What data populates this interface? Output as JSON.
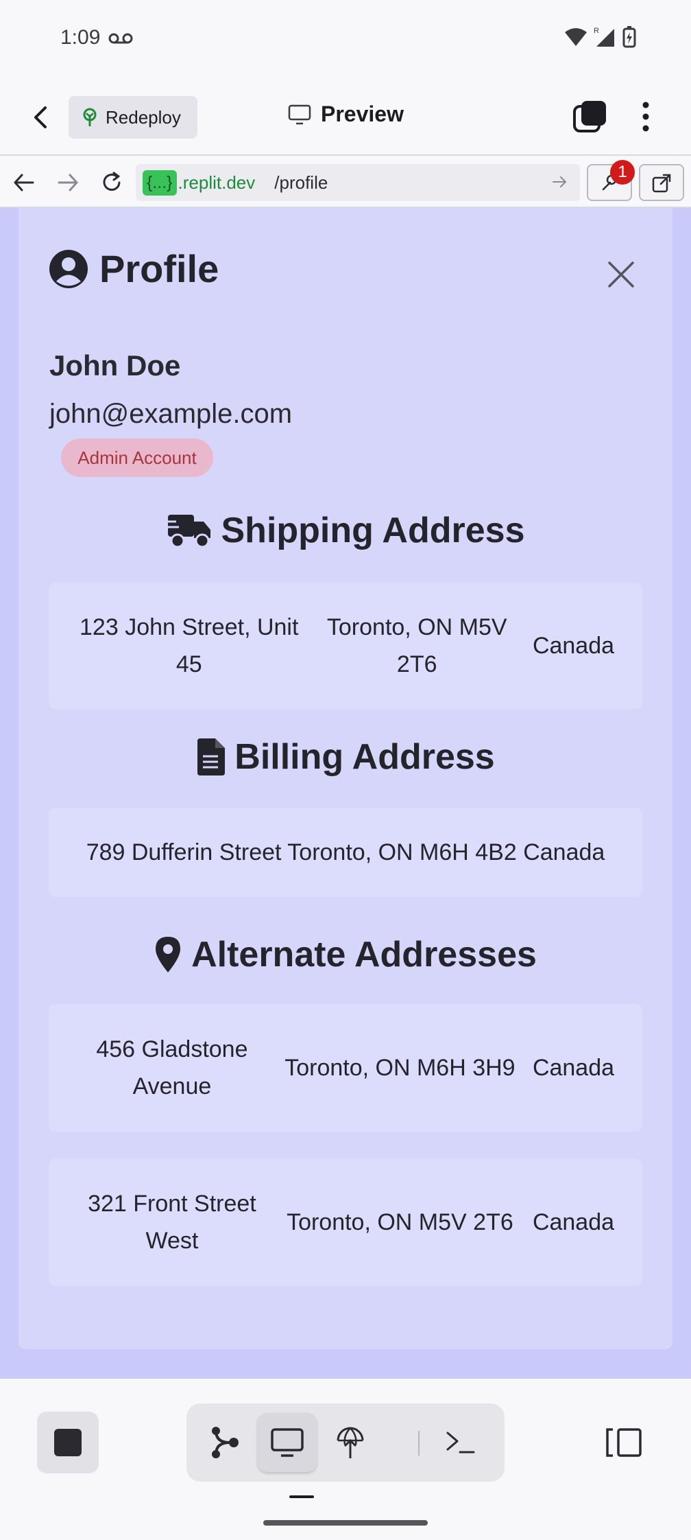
{
  "status_bar": {
    "time": "1:09"
  },
  "toolbar": {
    "redeploy_label": "Redeploy",
    "preview_label": "Preview"
  },
  "urlbar": {
    "badge": "{...}",
    "domain": ".replit.dev",
    "path": "/profile",
    "devtools_count": "1"
  },
  "profile": {
    "title": "Profile",
    "name": "John Doe",
    "email": "john@example.com",
    "account_badge": "Admin Account"
  },
  "shipping": {
    "title": "Shipping Address",
    "street": "123 John Street, Unit 45",
    "city": "Toronto, ON M5V 2T6",
    "country": "Canada"
  },
  "billing": {
    "title": "Billing Address",
    "full": "789 Dufferin Street Toronto, ON M6H 4B2 Canada"
  },
  "alternate": {
    "title": "Alternate Addresses",
    "items": [
      {
        "street": "456 Gladstone Avenue",
        "city": "Toronto, ON M6H 3H9",
        "country": "Canada"
      },
      {
        "street": "321 Front Street West",
        "city": "Toronto, ON M5V 2T6",
        "country": "Canada"
      }
    ]
  },
  "colors": {
    "page_bg": "#c9c9fa",
    "panel_bg": "#d6d6fb",
    "badge_bg": "#eab8cc",
    "badge_text": "#a8343c",
    "url_badge": "#3ac25a"
  },
  "icons": {
    "profile": "user-circle-icon",
    "shipping": "truck-icon",
    "billing": "document-icon",
    "alternate": "map-pin-icon"
  }
}
